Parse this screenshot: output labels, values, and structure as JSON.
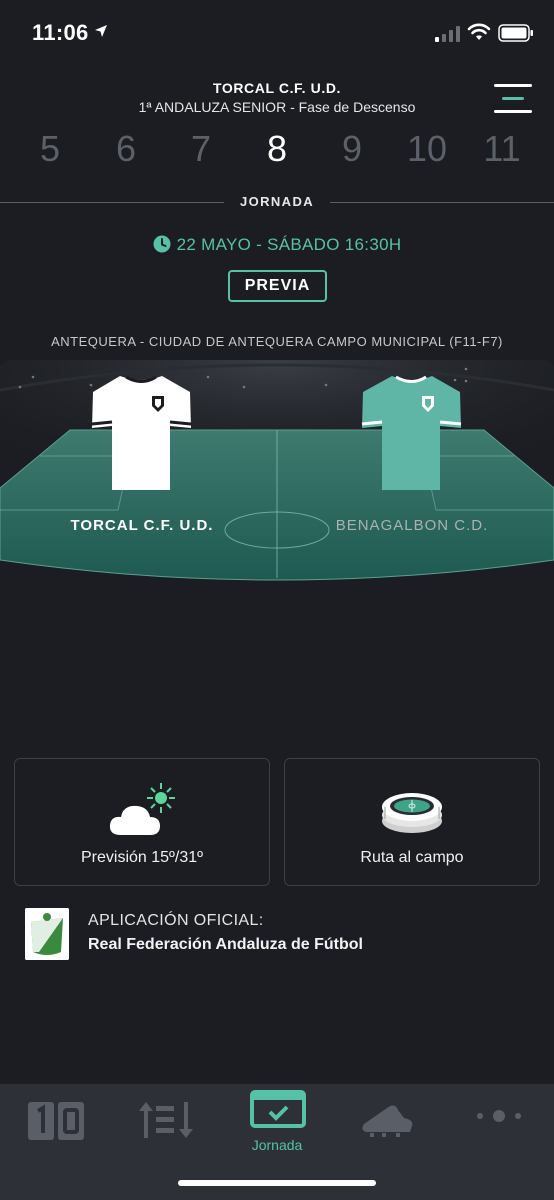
{
  "status": {
    "time": "11:06"
  },
  "header": {
    "team": "TORCAL C.F. U.D.",
    "league": "1ª ANDALUZA SENIOR - Fase de Descenso"
  },
  "rounds": [
    "5",
    "6",
    "7",
    "8",
    "9",
    "10",
    "11"
  ],
  "active_round": "8",
  "jornada_label": "JORNADA",
  "match": {
    "date": "22 MAYO - SÁBADO 16:30H",
    "status_badge": "PREVIA",
    "venue": "ANTEQUERA - CIUDAD DE ANTEQUERA CAMPO MUNICIPAL (F11-F7)",
    "home_team": "TORCAL C.F. U.D.",
    "away_team": "BENAGALBON C.D."
  },
  "cards": {
    "weather": "Previsión 15º/31º",
    "route": "Ruta al campo"
  },
  "official": {
    "label": "APLICACIÓN OFICIAL:",
    "name": "Real Federación Andaluza de Fútbol"
  },
  "tabs": {
    "active_label": "Jornada"
  },
  "colors": {
    "accent": "#56c1a6",
    "background": "#1b1d22",
    "tab_bar": "#2d3037",
    "away_shirt": "#5fb6a6"
  }
}
